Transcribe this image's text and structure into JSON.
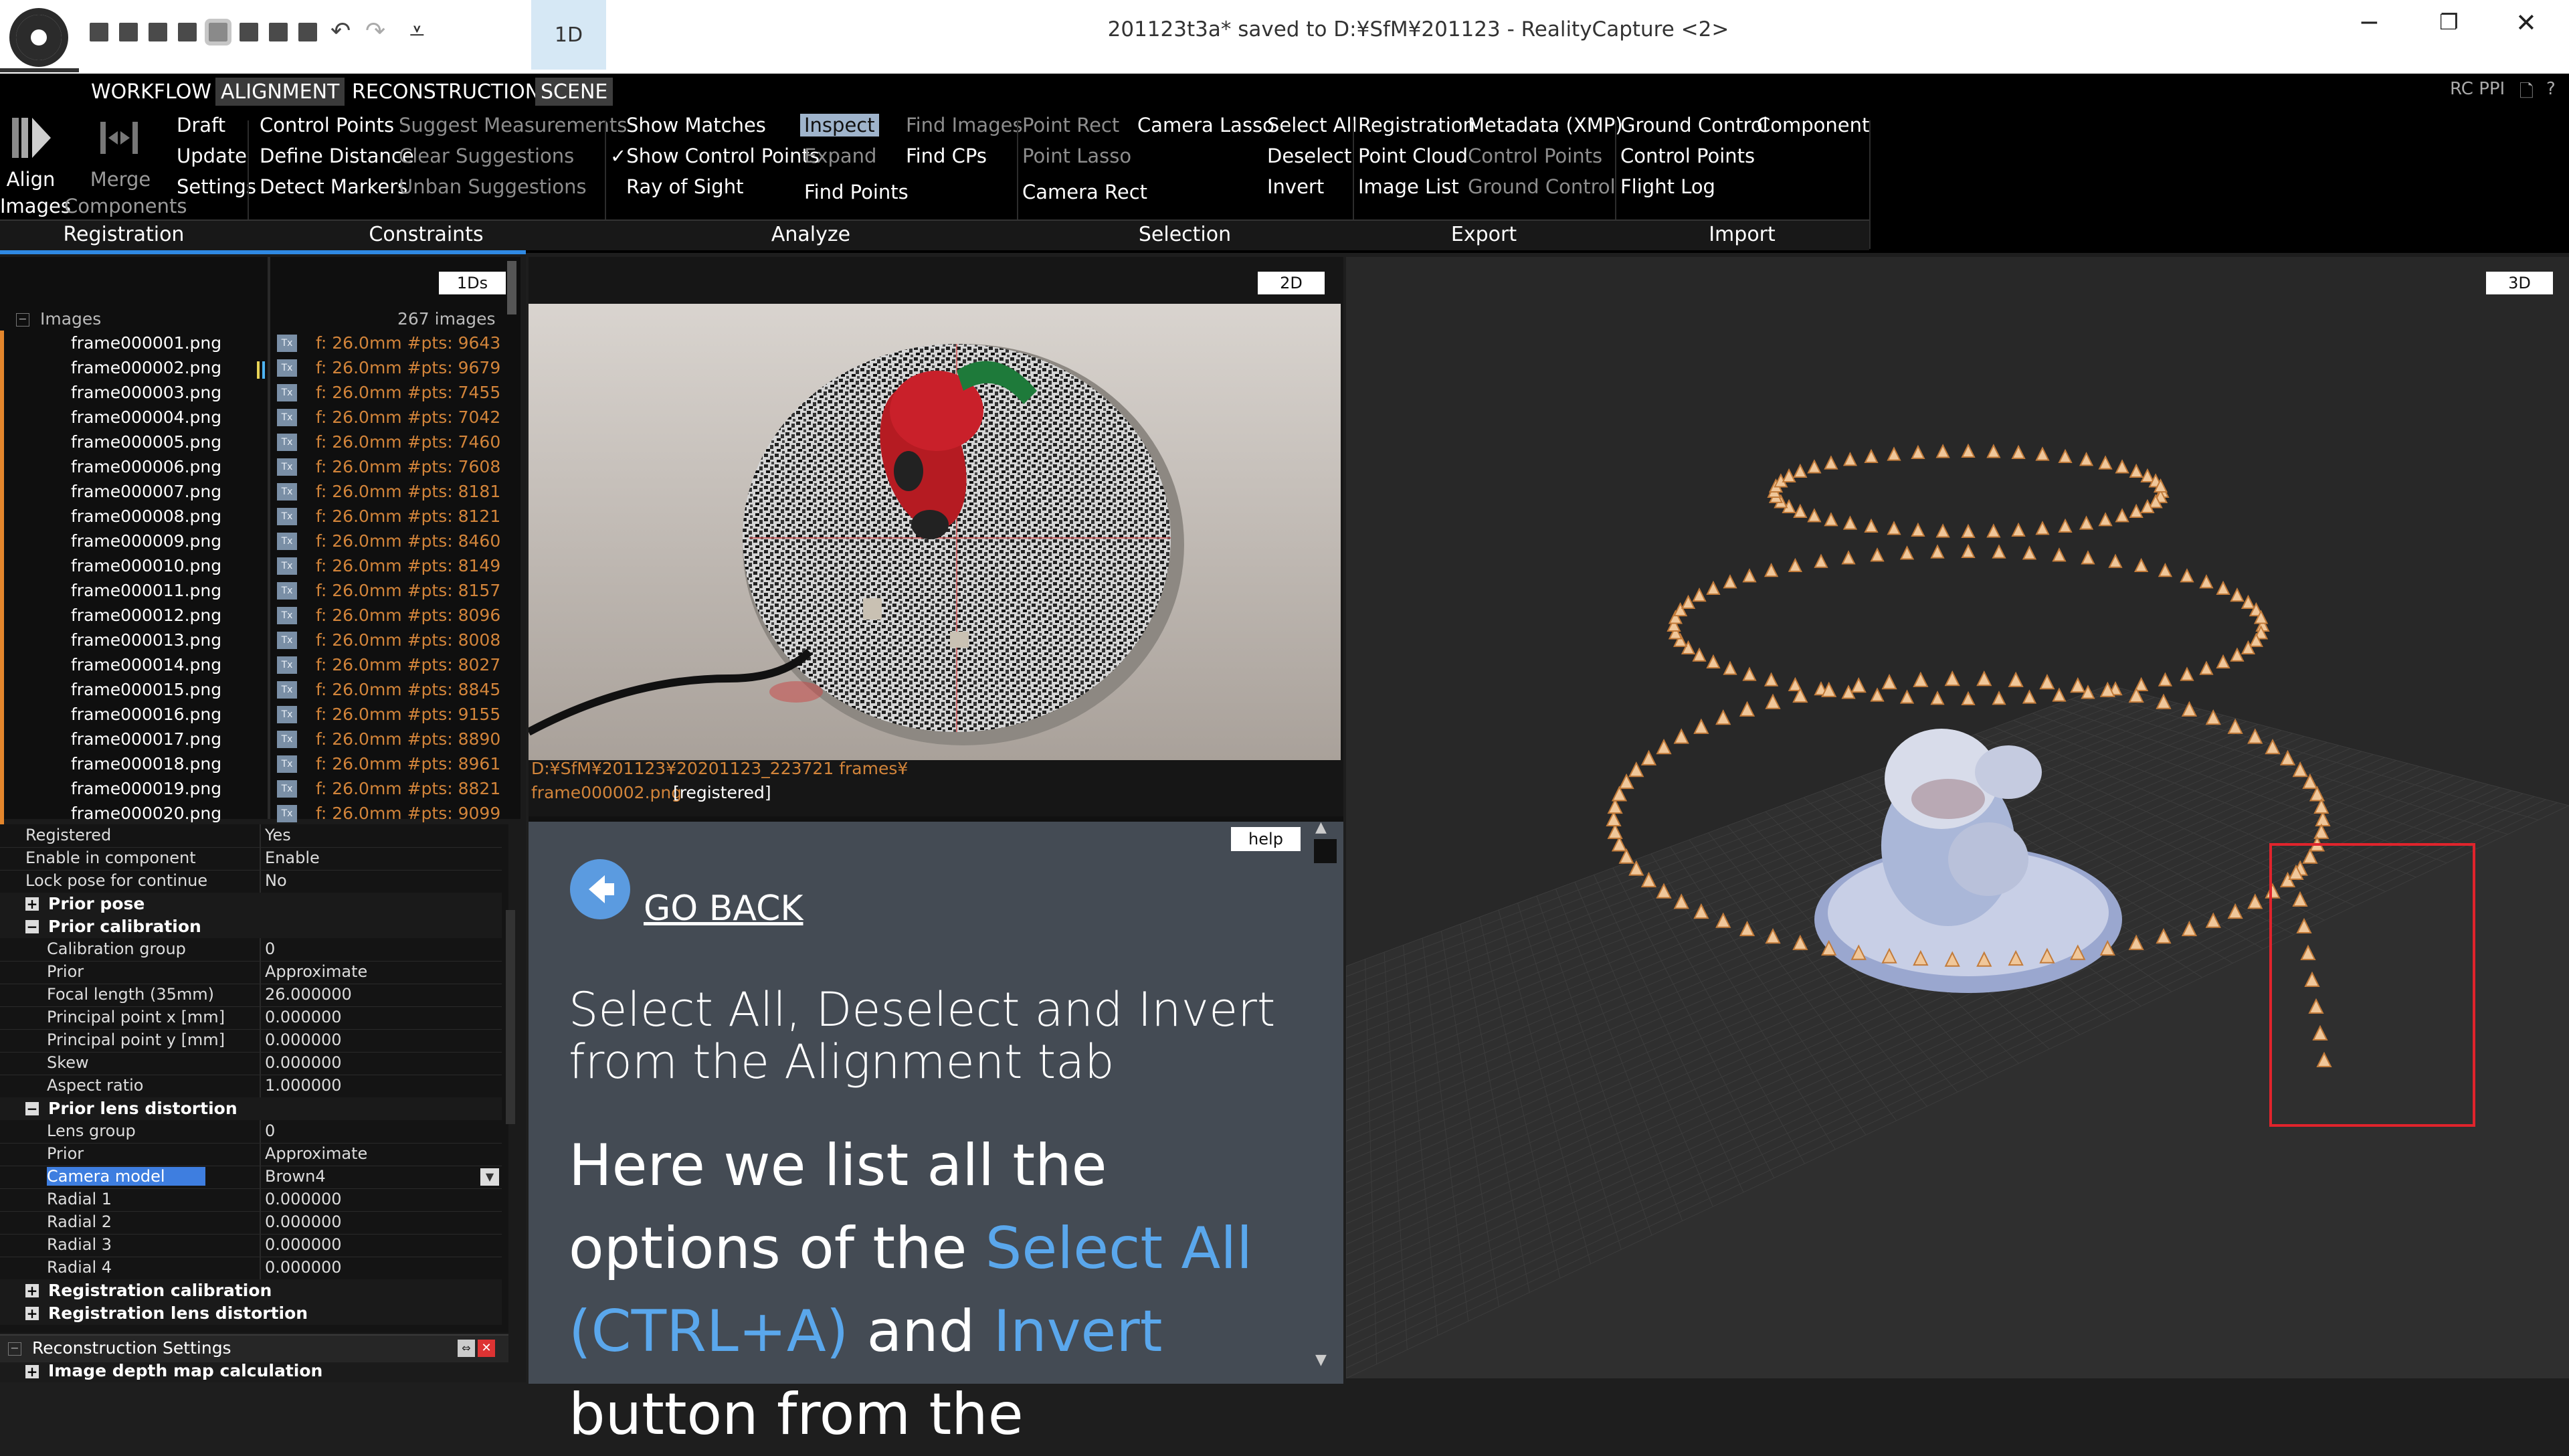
{
  "titlebar": {
    "window_title": "201123t3a* saved to D:¥SfM¥201123 - RealityCapture <2>",
    "layout_tab": "1D"
  },
  "ribbon": {
    "tabs": [
      "WORKFLOW",
      "ALIGNMENT",
      "RECONSTRUCTION",
      "SCENE"
    ],
    "active_tab": "ALIGNMENT",
    "rc_ppi": "RC PPI",
    "big_buttons": {
      "align_images": [
        "Align",
        "Images"
      ],
      "merge_components": [
        "Merge",
        "Components"
      ]
    },
    "registration": [
      "Draft",
      "Update",
      "Settings"
    ],
    "constraints_col1": [
      "Control Points",
      "Define Distance",
      "Detect Markers"
    ],
    "constraints_col2": [
      "Suggest Measurements",
      "Clear Suggestions",
      "Unban Suggestions"
    ],
    "analyze_col1": [
      "Show Matches",
      "✓Show Control Points",
      "Ray of Sight"
    ],
    "analyze_col2": [
      "Inspect",
      "Expand",
      "Find Points"
    ],
    "analyze_col3": [
      "Find Images",
      "Find CPs"
    ],
    "selection_col1": [
      "Point Rect",
      "Point Lasso",
      "Camera Rect"
    ],
    "selection_col2": [
      "Camera Lasso"
    ],
    "selection_col3": [
      "Select All",
      "Deselect",
      "Invert"
    ],
    "export_col1": [
      "Registration",
      "Point Cloud",
      "Image List"
    ],
    "export_col2": [
      "Metadata (XMP)",
      "Control Points",
      "Ground Control"
    ],
    "import_col1": [
      "Ground Control",
      "Control Points",
      "Flight Log"
    ],
    "import_col2": [
      "Component"
    ],
    "groups": [
      "Registration",
      "Constraints",
      "Analyze",
      "Selection",
      "Export",
      "Import"
    ]
  },
  "left_panel": {
    "view_button": "1Ds",
    "images_label": "Images",
    "images_count": "267 images",
    "images": [
      {
        "name": "frame000001.png",
        "info": "f: 26.0mm #pts: 9643"
      },
      {
        "name": "frame000002.png",
        "info": "f: 26.0mm #pts: 9679"
      },
      {
        "name": "frame000003.png",
        "info": "f: 26.0mm #pts: 7455"
      },
      {
        "name": "frame000004.png",
        "info": "f: 26.0mm #pts: 7042"
      },
      {
        "name": "frame000005.png",
        "info": "f: 26.0mm #pts: 7460"
      },
      {
        "name": "frame000006.png",
        "info": "f: 26.0mm #pts: 7608"
      },
      {
        "name": "frame000007.png",
        "info": "f: 26.0mm #pts: 8181"
      },
      {
        "name": "frame000008.png",
        "info": "f: 26.0mm #pts: 8121"
      },
      {
        "name": "frame000009.png",
        "info": "f: 26.0mm #pts: 8460"
      },
      {
        "name": "frame000010.png",
        "info": "f: 26.0mm #pts: 8149"
      },
      {
        "name": "frame000011.png",
        "info": "f: 26.0mm #pts: 8157"
      },
      {
        "name": "frame000012.png",
        "info": "f: 26.0mm #pts: 8096"
      },
      {
        "name": "frame000013.png",
        "info": "f: 26.0mm #pts: 8008"
      },
      {
        "name": "frame000014.png",
        "info": "f: 26.0mm #pts: 8027"
      },
      {
        "name": "frame000015.png",
        "info": "f: 26.0mm #pts: 8845"
      },
      {
        "name": "frame000016.png",
        "info": "f: 26.0mm #pts: 9155"
      },
      {
        "name": "frame000017.png",
        "info": "f: 26.0mm #pts: 8890"
      },
      {
        "name": "frame000018.png",
        "info": "f: 26.0mm #pts: 8961"
      },
      {
        "name": "frame000019.png",
        "info": "f: 26.0mm #pts: 8821"
      },
      {
        "name": "frame000020.png",
        "info": "f: 26.0mm #pts: 9099"
      }
    ],
    "tx_label": "Tx",
    "properties": {
      "top_rows": [
        {
          "k": "Registered",
          "v": "Yes"
        },
        {
          "k": "Enable in component",
          "v": "Enable"
        },
        {
          "k": "Lock pose for continue",
          "v": "No"
        }
      ],
      "prior_pose": "Prior pose",
      "prior_calibration": "Prior calibration",
      "calib_rows": [
        {
          "k": "Calibration group",
          "v": "0"
        },
        {
          "k": "Prior",
          "v": "Approximate"
        },
        {
          "k": "Focal length (35mm)",
          "v": "26.000000"
        },
        {
          "k": "Principal point x [mm]",
          "v": "0.000000"
        },
        {
          "k": "Principal point y [mm]",
          "v": "0.000000"
        },
        {
          "k": "Skew",
          "v": "0.000000"
        },
        {
          "k": "Aspect ratio",
          "v": "1.000000"
        }
      ],
      "prior_lens_distortion": "Prior lens distortion",
      "lens_rows": [
        {
          "k": "Lens group",
          "v": "0"
        },
        {
          "k": "Prior",
          "v": "Approximate"
        },
        {
          "k": "Camera model",
          "v": "Brown4"
        },
        {
          "k": "Radial 1",
          "v": "0.000000"
        },
        {
          "k": "Radial 2",
          "v": "0.000000"
        },
        {
          "k": "Radial 3",
          "v": "0.000000"
        },
        {
          "k": "Radial 4",
          "v": "0.000000"
        }
      ],
      "registration_calibration": "Registration calibration",
      "registration_lens_distortion": "Registration lens distortion",
      "plus": "+",
      "minus": "−"
    },
    "reconstruction_settings": "Reconstruction Settings",
    "image_depth": "Image depth map calculation"
  },
  "view2d": {
    "button": "2D",
    "path_line1": "D:¥SfM¥201123¥20201123_223721 frames¥",
    "path_line2": "frame000002.png",
    "status": "[registered]"
  },
  "help": {
    "button": "help",
    "go_back": "GO BACK",
    "title": "Select All, Deselect and Invert from the Alignment tab",
    "body_1": "Here we list all the options of the ",
    "body_hl1": "Select All (CTRL+A)",
    "body_2": " and ",
    "body_hl2": "Invert",
    "body_3": " button from the"
  },
  "view3d": {
    "button": "3D"
  },
  "colors": {
    "accent_blue": "#2f89e3",
    "info_orange": "#d2843a",
    "selection_red": "#e0242c",
    "help_bg": "#444b54"
  }
}
